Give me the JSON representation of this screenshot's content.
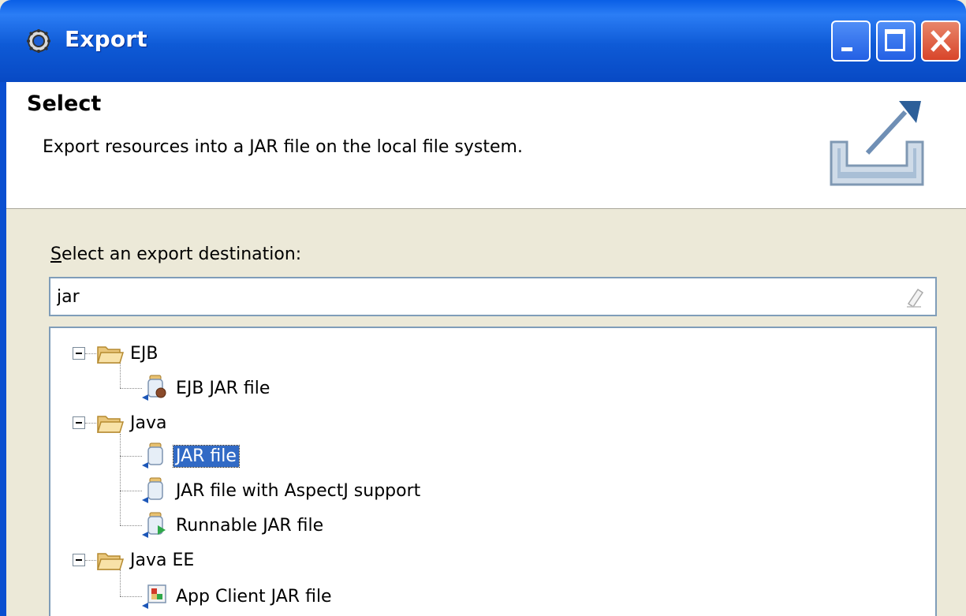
{
  "window": {
    "title": "Export"
  },
  "header": {
    "title": "Select",
    "description": "Export resources into a JAR file on the local file system."
  },
  "body": {
    "destination_label_first": "S",
    "destination_label_rest": "elect an export destination:",
    "filter_value": "jar"
  },
  "tree": {
    "cat_ejb": "EJB",
    "ejb_jar": "EJB JAR file",
    "cat_java": "Java",
    "jar_file": "JAR file",
    "jar_aspectj": "JAR file with AspectJ support",
    "runnable_jar": "Runnable JAR file",
    "cat_javaee": "Java EE",
    "app_client_jar": "App Client JAR file"
  }
}
